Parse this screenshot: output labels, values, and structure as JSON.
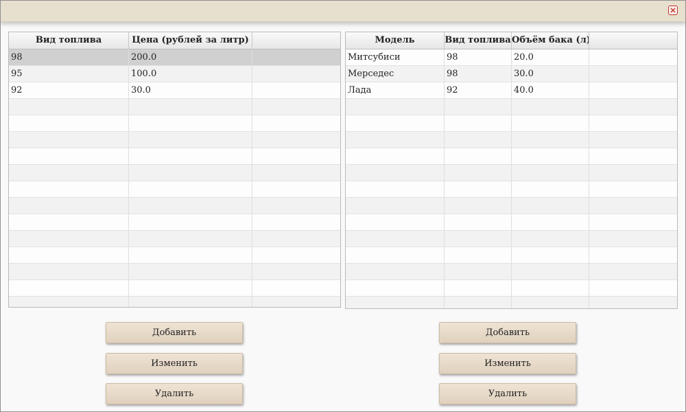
{
  "window": {
    "close_icon": "close-icon",
    "close_color": "#c0392b"
  },
  "fuel_table": {
    "columns": [
      "Вид топлива",
      "Цена (рублей за литр)",
      ""
    ],
    "rows": [
      [
        "98",
        "200.0",
        ""
      ],
      [
        "95",
        "100.0",
        ""
      ],
      [
        "92",
        "30.0",
        ""
      ]
    ],
    "selected_row": 0
  },
  "car_table": {
    "columns": [
      "Модель",
      "Вид топлива",
      "Объём бака (л)",
      ""
    ],
    "rows": [
      [
        "Митсубиси",
        "98",
        "20.0",
        ""
      ],
      [
        "Мерседес",
        "98",
        "30.0",
        ""
      ],
      [
        "Лада",
        "92",
        "40.0",
        ""
      ]
    ]
  },
  "fuel_buttons": {
    "add": "Добавить",
    "edit": "Изменить",
    "delete": "Удалить"
  },
  "car_buttons": {
    "add": "Добавить",
    "edit": "Изменить",
    "delete": "Удалить"
  }
}
